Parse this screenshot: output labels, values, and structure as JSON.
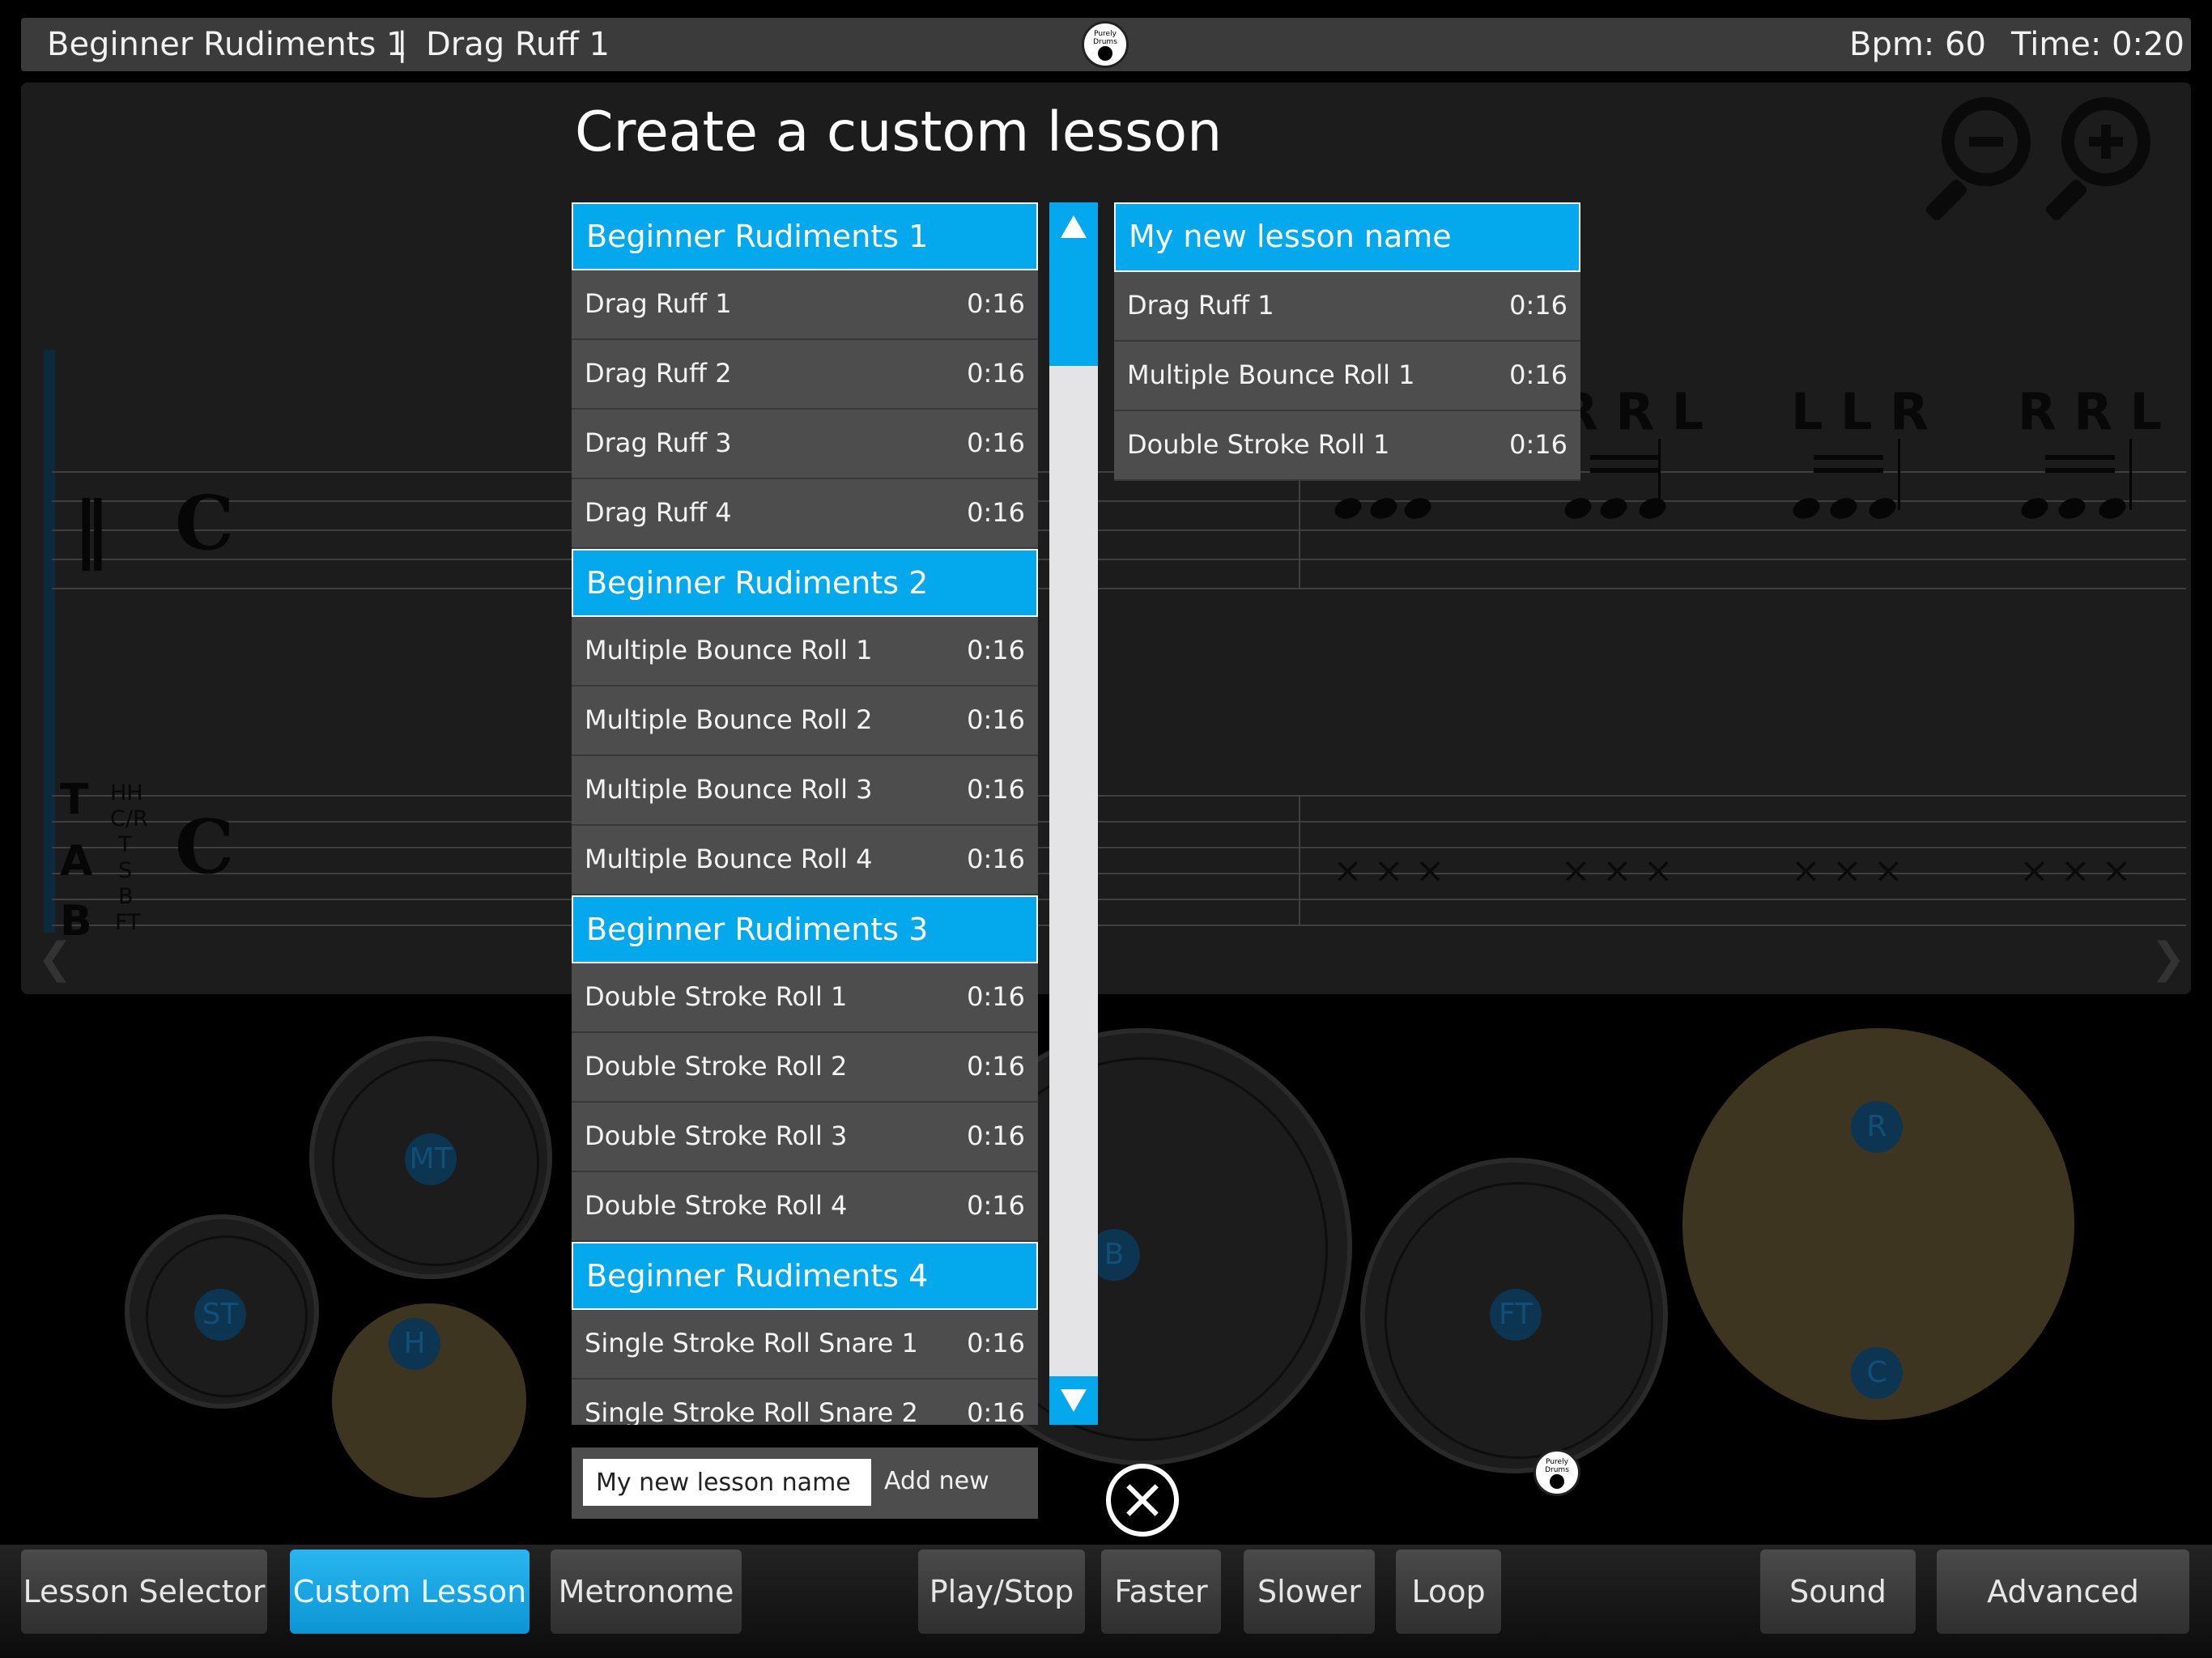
{
  "topbar": {
    "lesson": "Beginner Rudiments 1",
    "separator": "|",
    "exercise": "Drag Ruff 1",
    "bpm": "Bpm: 60",
    "time": "Time: 0:20",
    "logo_text": "Purely Drums"
  },
  "notation": {
    "tab_letters": [
      "T",
      "A",
      "B"
    ],
    "tab_voices": [
      "HH",
      "C/R",
      "T",
      "S",
      "B",
      "FT"
    ],
    "sticking_groups": [
      {
        "text": "R R L"
      },
      {
        "text": "L L R"
      },
      {
        "text": "R R L"
      }
    ],
    "icons": {
      "zoom_out": "zoom-out-icon",
      "zoom_in": "zoom-in-icon",
      "prev": "chevron-left-icon",
      "next": "chevron-right-icon"
    }
  },
  "drumkit": {
    "labels": {
      "mt": "MT",
      "st": "ST",
      "h": "H",
      "b": "B",
      "ft": "FT",
      "r": "R",
      "c": "C"
    }
  },
  "dialog": {
    "title": "Create a custom lesson",
    "groups": [
      {
        "name": "Beginner Rudiments 1",
        "items": [
          {
            "name": "Drag Ruff 1",
            "dur": "0:16"
          },
          {
            "name": "Drag Ruff 2",
            "dur": "0:16"
          },
          {
            "name": "Drag Ruff 3",
            "dur": "0:16"
          },
          {
            "name": "Drag Ruff 4",
            "dur": "0:16"
          }
        ]
      },
      {
        "name": "Beginner Rudiments 2",
        "items": [
          {
            "name": "Multiple Bounce Roll 1",
            "dur": "0:16"
          },
          {
            "name": "Multiple Bounce Roll 2",
            "dur": "0:16"
          },
          {
            "name": "Multiple Bounce Roll 3",
            "dur": "0:16"
          },
          {
            "name": "Multiple Bounce Roll 4",
            "dur": "0:16"
          }
        ]
      },
      {
        "name": "Beginner Rudiments 3",
        "items": [
          {
            "name": "Double Stroke Roll 1",
            "dur": "0:16"
          },
          {
            "name": "Double Stroke Roll 2",
            "dur": "0:16"
          },
          {
            "name": "Double Stroke Roll 3",
            "dur": "0:16"
          },
          {
            "name": "Double Stroke Roll 4",
            "dur": "0:16"
          }
        ]
      },
      {
        "name": "Beginner Rudiments 4",
        "items": [
          {
            "name": "Single Stroke Roll Snare 1",
            "dur": "0:16"
          },
          {
            "name": "Single Stroke Roll Snare 2",
            "dur": "0:16"
          }
        ]
      }
    ],
    "new_lesson": {
      "name": "My new lesson name",
      "items": [
        {
          "name": "Drag Ruff 1",
          "dur": "0:16"
        },
        {
          "name": "Multiple Bounce Roll 1",
          "dur": "0:16"
        },
        {
          "name": "Double Stroke Roll 1",
          "dur": "0:16"
        }
      ]
    },
    "input_value": "My new lesson name",
    "add_label": "Add new",
    "icons": {
      "scroll_up": "triangle-up-icon",
      "scroll_down": "triangle-down-icon",
      "close": "close-circle-icon"
    }
  },
  "toolbar": {
    "lesson_selector": "Lesson Selector",
    "custom_lesson": "Custom Lesson",
    "metronome": "Metronome",
    "play_stop": "Play/Stop",
    "faster": "Faster",
    "slower": "Slower",
    "loop": "Loop",
    "sound": "Sound",
    "advanced": "Advanced",
    "active_color": "#03a9ec"
  }
}
